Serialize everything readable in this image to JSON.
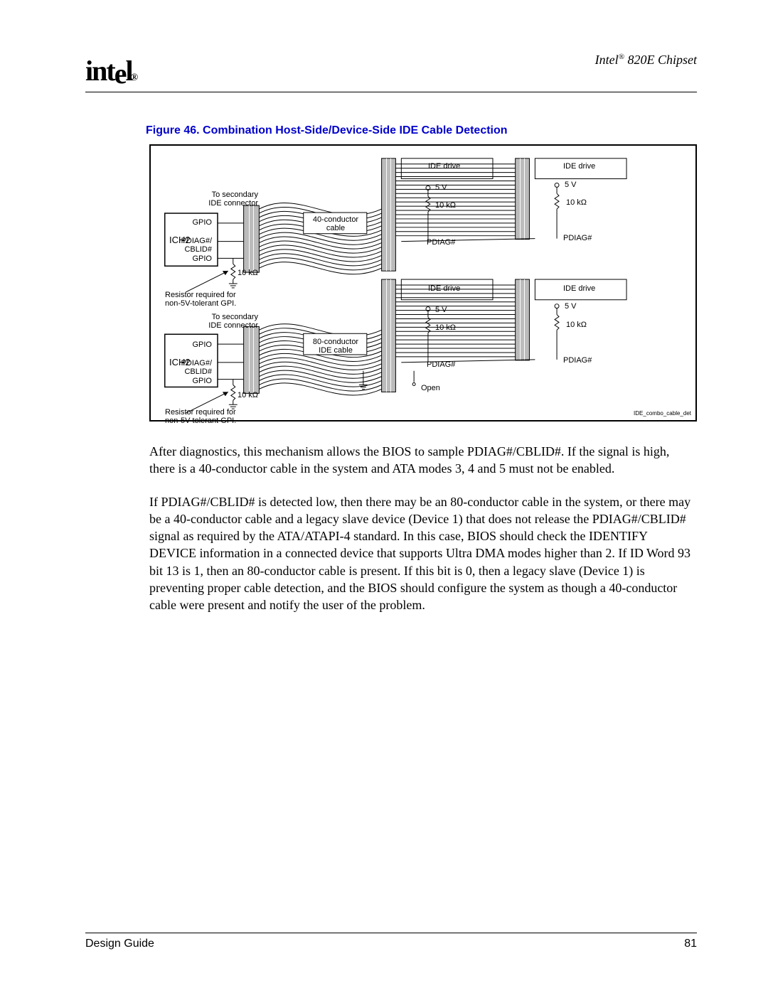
{
  "header": {
    "logo_text": "intel",
    "chipset": "Intel",
    "chipset_reg": "®",
    "chipset_tail": " 820E Chipset"
  },
  "figure": {
    "caption": "Figure 46. Combination Host-Side/Device-Side IDE Cable Detection",
    "labels": {
      "ide_drive": "IDE drive",
      "five_v": "5 V",
      "ten_k": "10 kΩ",
      "pdiag": "PDIAG#",
      "ich2": "ICH2",
      "gpio": "GPIO",
      "pdiag_cblid": "PDIAG#/",
      "cblid": "CBLID#",
      "to_secondary": "To secondary",
      "ide_connector": "IDE connector",
      "forty_cond": "40-conductor",
      "forty_cable": "cable",
      "eighty_cond": "80-conductor",
      "eighty_cable": "IDE cable",
      "resistor_req": "Resistor required for",
      "non5v_gpi": "non-5V-tolerant GPI.",
      "open": "Open",
      "footer_code": "IDE_combo_cable_det"
    }
  },
  "body": {
    "p1": "After diagnostics, this mechanism allows the BIOS to sample PDIAG#/CBLID#. If the signal is high, there is a 40-conductor cable in the system and ATA modes 3, 4 and 5 must not be enabled.",
    "p2": "If PDIAG#/CBLID# is detected low, then there may be an 80-conductor cable in the system, or there may be a 40-conductor cable and a legacy slave device (Device 1) that does not release the PDIAG#/CBLID# signal as required by the ATA/ATAPI-4 standard. In this case, BIOS should check the IDENTIFY DEVICE information in a connected device that supports Ultra DMA modes higher than 2. If ID Word 93 bit 13 is 1, then an 80-conductor cable is present. If this bit is 0, then a legacy slave (Device 1) is preventing proper cable detection, and the BIOS should configure the system as though a 40-conductor cable were present and notify the user of the problem."
  },
  "footer": {
    "doc": "Design Guide",
    "page": "81"
  }
}
